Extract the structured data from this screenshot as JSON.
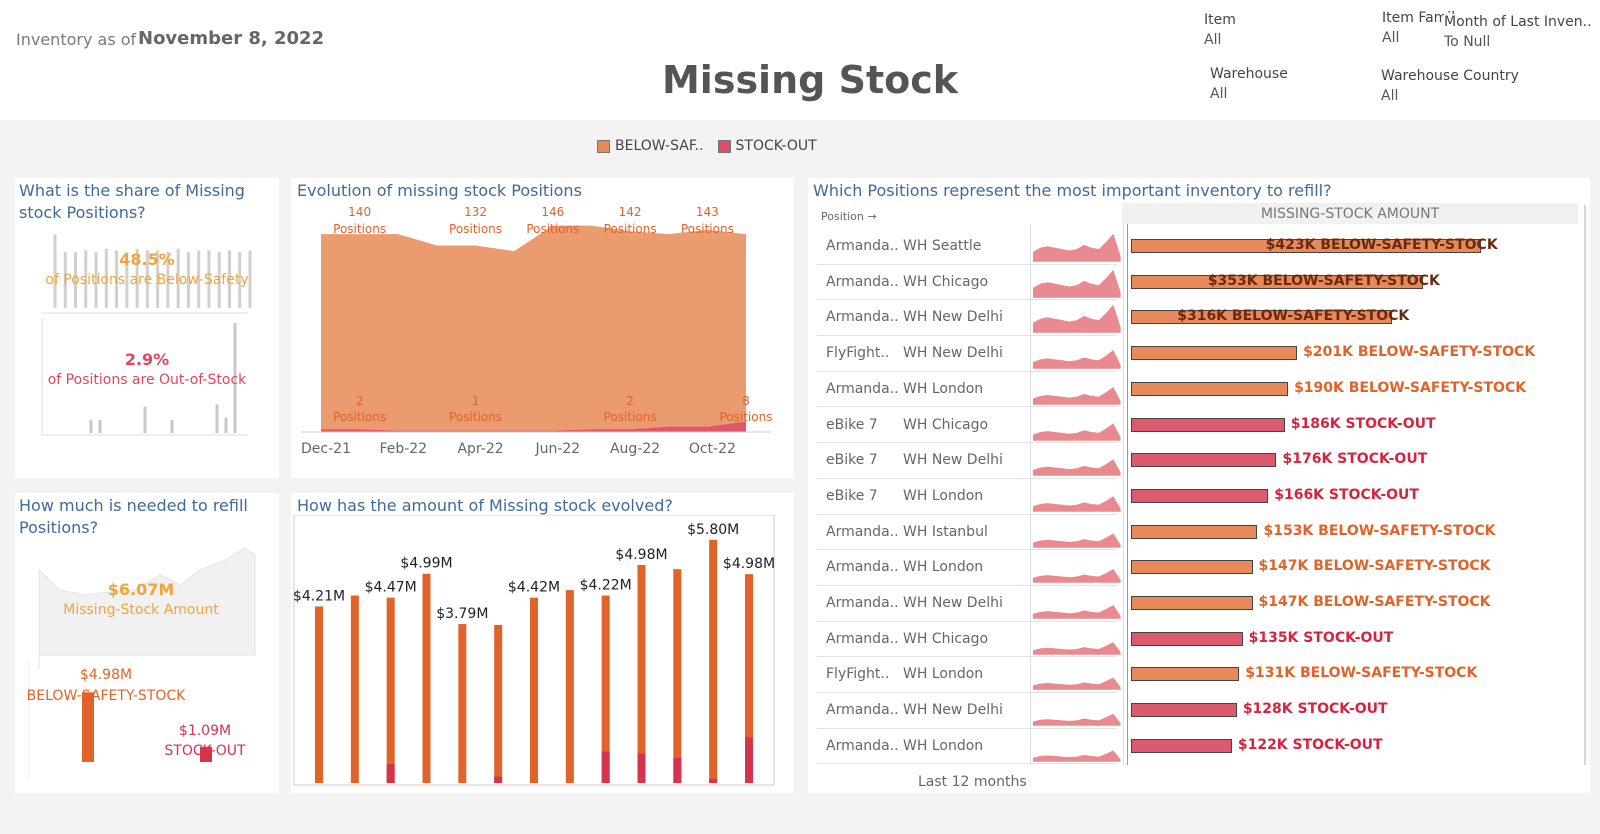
{
  "header": {
    "inventory_label": "Inventory as of",
    "inventory_date": "November 8, 2022",
    "title": "Missing Stock"
  },
  "filters": [
    {
      "label": "Item",
      "value": "All"
    },
    {
      "label": "Item Family",
      "value": "All"
    },
    {
      "label": "Month of Last Inven..",
      "value": "To Null"
    },
    {
      "label": "Warehouse",
      "value": "All"
    },
    {
      "label": "Warehouse Country",
      "value": "All"
    }
  ],
  "legend": [
    {
      "label": "BELOW-SAF..",
      "color": "#e8895a"
    },
    {
      "label": "STOCK-OUT",
      "color": "#d94f6a"
    }
  ],
  "share_panel": {
    "title": "What is the share of Missing stock Positions?",
    "below_pct": "48.5%",
    "below_text": "of Positions are Below-Safety",
    "out_pct": "2.9%",
    "out_text": "of Positions are Out-of-Stock",
    "below_bars": [
      0.92,
      0.7,
      0.7,
      0.72,
      0.7,
      0.74,
      0.72,
      0.7,
      0.74,
      0.72,
      0.72,
      0.7,
      0.74,
      0.7,
      0.72,
      0.72,
      0.7,
      0.72,
      0.7,
      0.72
    ],
    "out_bars": [
      0,
      0,
      0,
      0,
      0.12,
      0.12,
      0,
      0,
      0,
      0,
      0.24,
      0,
      0,
      0.12,
      0,
      0,
      0,
      0,
      0.26,
      0.14,
      1.0
    ]
  },
  "refill_panel": {
    "title": "How much is needed to refill Positions?",
    "total_amount": "$6.07M",
    "total_label": "Missing-Stock Amount",
    "below_amount": "$4.98M",
    "below_label": "BELOW-SAFETY-STOCK",
    "out_amount": "$1.09M",
    "out_label": "STOCK-OUT",
    "below_value": 4.98,
    "out_value": 1.09
  },
  "evolution_panel": {
    "title": "Evolution of missing stock Positions",
    "positions_word": "Positions"
  },
  "amount_panel": {
    "title": "How has the amount of Missing stock evolved?"
  },
  "table_panel": {
    "title": "Which Positions represent the most important inventory to refill?",
    "position_header": "Position",
    "amount_header": "MISSING-STOCK AMOUNT",
    "footer": "Last 12 months"
  },
  "chart_data": [
    {
      "type": "area",
      "title": "Evolution of missing stock Positions",
      "x": [
        "Dec-21",
        "Jan-22",
        "Feb-22",
        "Mar-22",
        "Apr-22",
        "May-22",
        "Jun-22",
        "Jul-22",
        "Aug-22",
        "Sep-22",
        "Oct-22",
        "Nov-22"
      ],
      "x_tick_labels": [
        "Dec-21",
        "Feb-22",
        "Apr-22",
        "Jun-22",
        "Aug-22",
        "Oct-22"
      ],
      "ylim": [
        0,
        150
      ],
      "series": [
        {
          "name": "BELOW-SAF..",
          "values": [
            140,
            140,
            140,
            132,
            132,
            128,
            146,
            146,
            142,
            140,
            143,
            140
          ]
        },
        {
          "name": "STOCK-OUT",
          "values": [
            2,
            2,
            1,
            1,
            1,
            1,
            1,
            2,
            2,
            4,
            4,
            8
          ]
        }
      ],
      "top_labels": [
        {
          "x": "Jan-22",
          "value": "140"
        },
        {
          "x": "Apr-22",
          "value": "132"
        },
        {
          "x": "Jun-22",
          "value": "146"
        },
        {
          "x": "Aug-22",
          "value": "142"
        },
        {
          "x": "Oct-22",
          "value": "143"
        }
      ],
      "bottom_labels": [
        {
          "x": "Jan-22",
          "value": "2"
        },
        {
          "x": "Apr-22",
          "value": "1"
        },
        {
          "x": "Aug-22",
          "value": "2"
        },
        {
          "x": "Nov-22",
          "value": "8"
        }
      ]
    },
    {
      "type": "bar",
      "title": "How has the amount of Missing stock evolved?",
      "categories": [
        "c1",
        "c2",
        "c3",
        "c4",
        "c5",
        "c6",
        "c7",
        "c8",
        "c9",
        "c10",
        "c11",
        "c12",
        "c13"
      ],
      "ylim": [
        0,
        6.2
      ],
      "series": [
        {
          "name": "BELOW-SAF..",
          "values": [
            4.21,
            4.47,
            4.42,
            4.99,
            3.79,
            3.77,
            4.42,
            4.6,
            4.47,
            5.2,
            5.1,
            5.8,
            4.98
          ]
        },
        {
          "name": "STOCK-OUT",
          "values": [
            0,
            0,
            0.45,
            0,
            0,
            0.15,
            0,
            0,
            0.75,
            0.7,
            0.6,
            0.1,
            1.09
          ]
        }
      ],
      "labels": [
        {
          "index": 0,
          "text": "$4.21M"
        },
        {
          "index": 2,
          "text": "$4.47M"
        },
        {
          "index": 3,
          "text": "$4.99M"
        },
        {
          "index": 4,
          "text": "$3.79M"
        },
        {
          "index": 6,
          "text": "$4.42M"
        },
        {
          "index": 8,
          "text": "$4.22M"
        },
        {
          "index": 9,
          "text": "$4.98M"
        },
        {
          "index": 11,
          "text": "$5.80M"
        },
        {
          "index": 12,
          "text": "$4.98M"
        }
      ]
    },
    {
      "type": "bar",
      "title": "Which Positions represent the most important inventory to refill?",
      "orientation": "horizontal",
      "xlim": [
        0,
        450
      ],
      "rows": [
        {
          "item": "Armanda..",
          "warehouse": "WH Seattle",
          "value": 423,
          "label": "$423K BELOW-SAFETY-STOCK",
          "type": "below"
        },
        {
          "item": "Armanda..",
          "warehouse": "WH Chicago",
          "value": 353,
          "label": "$353K BELOW-SAFETY-STOCK",
          "type": "below"
        },
        {
          "item": "Armanda..",
          "warehouse": "WH New Delhi",
          "value": 316,
          "label": "$316K BELOW-SAFETY-STOCK",
          "type": "below"
        },
        {
          "item": "FlyFight..",
          "warehouse": "WH New Delhi",
          "value": 201,
          "label": "$201K BELOW-SAFETY-STOCK",
          "type": "below"
        },
        {
          "item": "Armanda..",
          "warehouse": "WH London",
          "value": 190,
          "label": "$190K BELOW-SAFETY-STOCK",
          "type": "below"
        },
        {
          "item": "eBike 7",
          "warehouse": "WH Chicago",
          "value": 186,
          "label": "$186K STOCK-OUT",
          "type": "out"
        },
        {
          "item": "eBike 7",
          "warehouse": "WH New Delhi",
          "value": 176,
          "label": "$176K STOCK-OUT",
          "type": "out"
        },
        {
          "item": "eBike 7",
          "warehouse": "WH London",
          "value": 166,
          "label": "$166K STOCK-OUT",
          "type": "out"
        },
        {
          "item": "Armanda..",
          "warehouse": "WH Istanbul",
          "value": 153,
          "label": "$153K BELOW-SAFETY-STOCK",
          "type": "below"
        },
        {
          "item": "Armanda..",
          "warehouse": "WH London",
          "value": 147,
          "label": "$147K BELOW-SAFETY-STOCK",
          "type": "below"
        },
        {
          "item": "Armanda..",
          "warehouse": "WH New Delhi",
          "value": 147,
          "label": "$147K BELOW-SAFETY-STOCK",
          "type": "below"
        },
        {
          "item": "Armanda..",
          "warehouse": "WH Chicago",
          "value": 135,
          "label": "$135K STOCK-OUT",
          "type": "out"
        },
        {
          "item": "FlyFight..",
          "warehouse": "WH London",
          "value": 131,
          "label": "$131K BELOW-SAFETY-STOCK",
          "type": "below"
        },
        {
          "item": "Armanda..",
          "warehouse": "WH New Delhi",
          "value": 128,
          "label": "$128K STOCK-OUT",
          "type": "out"
        },
        {
          "item": "Armanda..",
          "warehouse": "WH London",
          "value": 122,
          "label": "$122K STOCK-OUT",
          "type": "out"
        }
      ]
    }
  ]
}
